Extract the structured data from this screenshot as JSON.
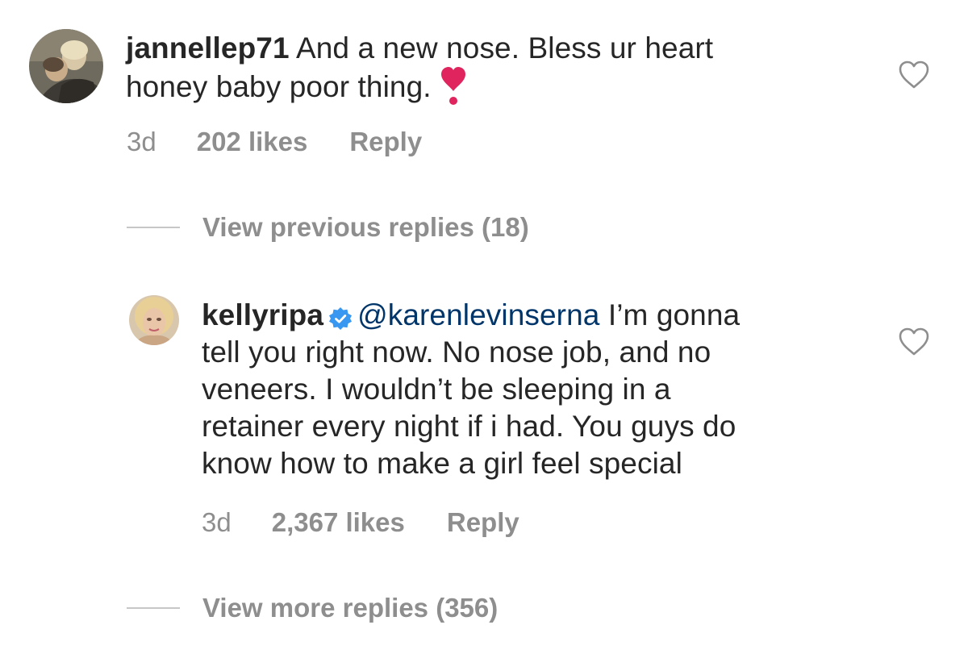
{
  "comments": [
    {
      "username": "jannellep71",
      "line1": " And a new nose. Bless ur heart",
      "line2": "honey baby poor thing.",
      "emoji_icon": "heart-exclamation-icon",
      "time": "3d",
      "likes": "202 likes",
      "reply": "Reply"
    },
    {
      "username": "kellyripa",
      "verified_icon": "verified-badge-icon",
      "mention": "@karenlevinserna",
      "line1_rest": " I’m gonna",
      "line2": "tell you right now. No nose job, and no",
      "line3": "veneers. I wouldn’t be sleeping in a",
      "line4": "retainer every night if i had. You guys do",
      "line5": "know how to make a girl feel special",
      "time": "3d",
      "likes": "2,367 likes",
      "reply": "Reply"
    }
  ],
  "view_previous_replies": "View previous replies (18)",
  "view_more_replies": "View more replies (356)",
  "colors": {
    "text": "#262626",
    "meta": "#8e8e8e",
    "mention": "#003569",
    "verified": "#3897f0",
    "emoji_red": "#e0245e"
  }
}
